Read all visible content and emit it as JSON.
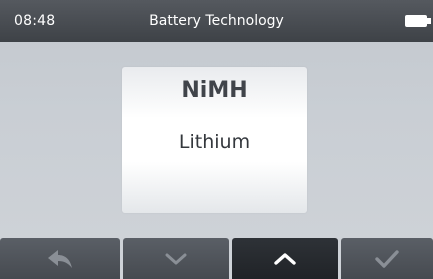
{
  "status_bar": {
    "time": "08:48",
    "title": "Battery Technology"
  },
  "selector": {
    "options": [
      "NiMH",
      "Lithium"
    ]
  },
  "nav": {
    "buttons": [
      {
        "icon": "back-arrow-icon"
      },
      {
        "icon": "chevron-down-icon"
      },
      {
        "icon": "chevron-up-icon",
        "active": true
      },
      {
        "icon": "checkmark-icon"
      }
    ]
  },
  "colors": {
    "status_bar": "#3e4247",
    "nav_button": "#4d5157",
    "nav_button_active": "#25282c",
    "background": "#c9ced4",
    "icon_muted": "#8a8f96",
    "icon_active": "#ffffff"
  }
}
